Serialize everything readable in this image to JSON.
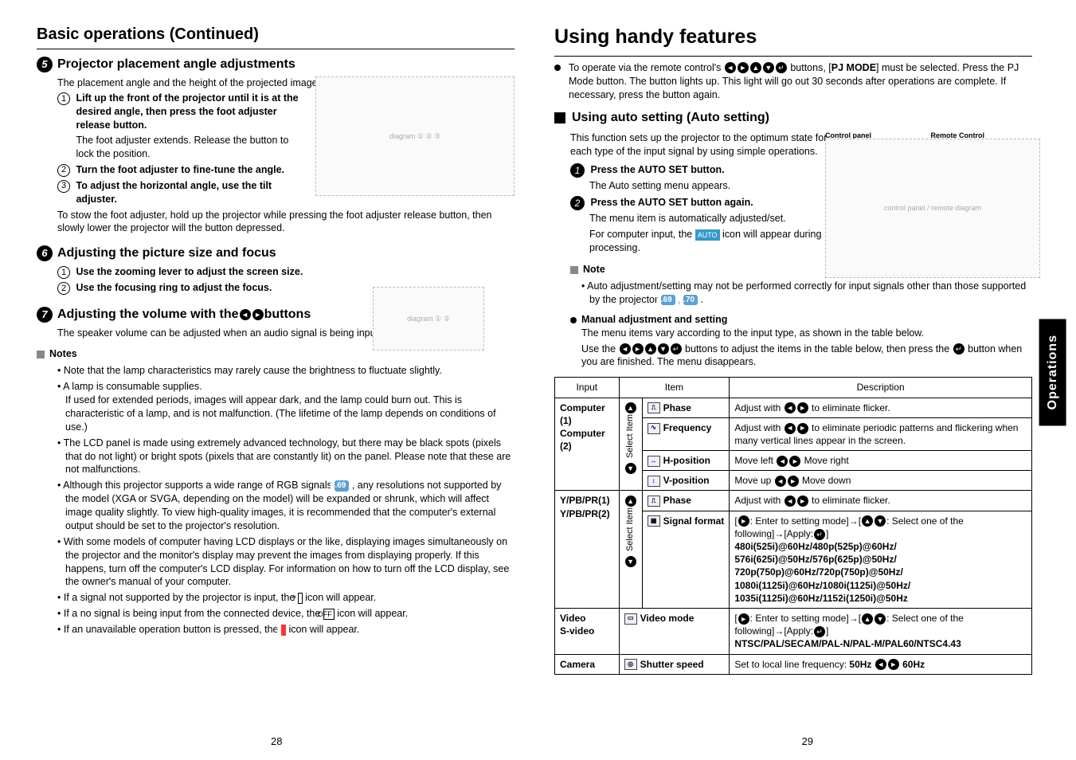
{
  "left": {
    "title": "Basic operations (Continued)",
    "s5": {
      "num": "5",
      "heading": "Projector placement angle adjustments",
      "intro": "The placement angle and the height of the projected image can be adjusted by the foot adjuster.",
      "step1": "Lift up the front of the projector until it is at the desired angle, then press the foot adjuster release button.",
      "step1_sub": "The foot adjuster extends. Release the button to lock the position.",
      "step2": "Turn the foot adjuster to fine-tune the angle.",
      "step3": "To adjust the horizontal angle, use the tilt adjuster.",
      "after": "To stow the foot adjuster, hold up the projector while pressing the foot adjuster release button, then slowly lower the projector will the button depressed."
    },
    "s6": {
      "num": "6",
      "heading": "Adjusting the picture size and focus",
      "step1": "Use the zooming lever to adjust the screen size.",
      "step2": "Use the focusing ring to adjust the focus."
    },
    "s7": {
      "num": "7",
      "heading_a": "Adjusting the volume with the ",
      "heading_b": " buttons",
      "p": "The speaker volume can be adjusted when an audio signal is being input."
    },
    "notes_h": "Notes",
    "notes": [
      "Note that the lamp characteristics may rarely cause the brightness to fluctuate slightly.",
      "A lamp is consumable supplies.\nIf used for extended periods, images will appear dark, and the lamp could burn out.  This is characteristic of a lamp, and is not malfunction. (The lifetime of the lamp depends on conditions of use.)",
      "The LCD panel is made using extremely advanced technology, but there may be black spots (pixels that do not light) or bright spots (pixels that are constantly lit) on the panel. Please note that these are not malfunctions."
    ],
    "note4_a": "Although this projector supports a wide range of RGB signals ",
    "note4_ref": "p.69",
    "note4_b": " , any resolutions not supported by the model (XGA or SVGA, depending on the model) will be expanded or shrunk, which will affect image quality slightly. To view high-quality images, it is recommended that the computer's external output should be set to the projector's resolution.",
    "note5": "With some models of computer having LCD displays or the like, displaying images simultaneously on the projector and the monitor's display may prevent the images from displaying properly. If this happens, turn off the computer's LCD display. For information on how to turn off the LCD display, see the owner's manual of your computer.",
    "note6_a": "If a signal not supported by the projector is input, the ",
    "note6_b": " icon will appear.",
    "note7_a": "If a no signal is being input from the connected device, the ",
    "note7_b": " icon will appear.",
    "note8_a": "If an unavailable operation button is pressed, the ",
    "note8_b": " icon will appear.",
    "page": "28"
  },
  "right": {
    "title": "Using handy features",
    "top_a": "To operate via the remote control's ",
    "top_b": " buttons, [",
    "top_mode": "PJ MODE",
    "top_c": "] must be selected. Press the PJ Mode button. The button lights up. This light will go out 30 seconds after operations are complete. If necessary, press the button again.",
    "auto_h": "Using auto setting (Auto setting)",
    "auto_intro": "This function sets up the projector to the optimum state for each type of the input signal by using simple operations.",
    "cp_label": "Control panel",
    "rc_label": "Remote Control",
    "auto_s1_h": "Press the AUTO SET button.",
    "auto_s1_p": "The Auto setting menu appears.",
    "auto_s2_h": "Press the AUTO SET button again.",
    "auto_s2_p1": "The menu item is automatically adjusted/set.",
    "auto_s2_p2a": "For computer input, the ",
    "auto_s2_p2b": " icon will appear during processing.",
    "note_h": "Note",
    "note_a": "Auto adjustment/setting may not be performed correctly for input signals other than those supported by the projector ",
    "note_ref1": "p.69",
    "note_ref2": "p.70",
    "manual_h": "Manual adjustment and setting",
    "manual_p1": "The menu items vary according to the input type, as shown in the table below.",
    "manual_p2a": "Use the ",
    "manual_p2b": " buttons to adjust the items in the table below, then press the ",
    "manual_p2c": " button when you are finished. The menu disappears.",
    "table": {
      "h_input": "Input",
      "h_item": "Item",
      "h_desc": "Description",
      "sel": "Select Item",
      "r1": {
        "input_a": "Computer (1)",
        "input_b": "Computer (2)",
        "items": [
          {
            "name": "Phase",
            "desc_a": "Adjust with ",
            "desc_b": " to eliminate flicker."
          },
          {
            "name": "Frequency",
            "desc_a": "Adjust with ",
            "desc_b": " to eliminate periodic patterns and flickering when many vertical lines appear in the screen."
          },
          {
            "name": "H-position",
            "desc_a": "Move left ",
            "desc_b": " Move right"
          },
          {
            "name": "V-position",
            "desc_a": "Move up ",
            "desc_b": " Move down"
          }
        ]
      },
      "r2": {
        "input_a": "Y/PB/PR(1)",
        "input_b": "Y/PB/PR(2)",
        "phase": {
          "name": "Phase",
          "desc_a": "Adjust with ",
          "desc_b": " to eliminate flicker."
        },
        "sf_name": "Signal format",
        "sf_a": "[",
        "sf_b": ": Enter to setting mode]→[",
        "sf_c": ": Select one of the following]→[Apply:",
        "sf_d": "]",
        "sf_modes": "480i(525i)@60Hz/480p(525p)@60Hz/\n576i(625i)@50Hz/576p(625p)@50Hz/\n720p(750p)@60Hz/720p(750p)@50Hz/\n1080i(1125i)@60Hz/1080i(1125i)@50Hz/\n1035i(1125i)@60Hz/1152i(1250i)@50Hz"
      },
      "r3": {
        "input_a": "Video",
        "input_b": "S-video",
        "vm_name": "Video mode",
        "vm_a": "[",
        "vm_b": ": Enter to setting mode]→[",
        "vm_c": ": Select one of the following]→[Apply:",
        "vm_d": "]",
        "vm_modes": "NTSC/PAL/SECAM/PAL-N/PAL-M/PAL60/NTSC4.43"
      },
      "r4": {
        "input": "Camera",
        "ss_name": "Shutter speed",
        "ss_a": "Set to local line frequency: ",
        "ss_50": "50Hz",
        "ss_60": "60Hz"
      }
    },
    "page": "29"
  },
  "side_tab": "Operations"
}
